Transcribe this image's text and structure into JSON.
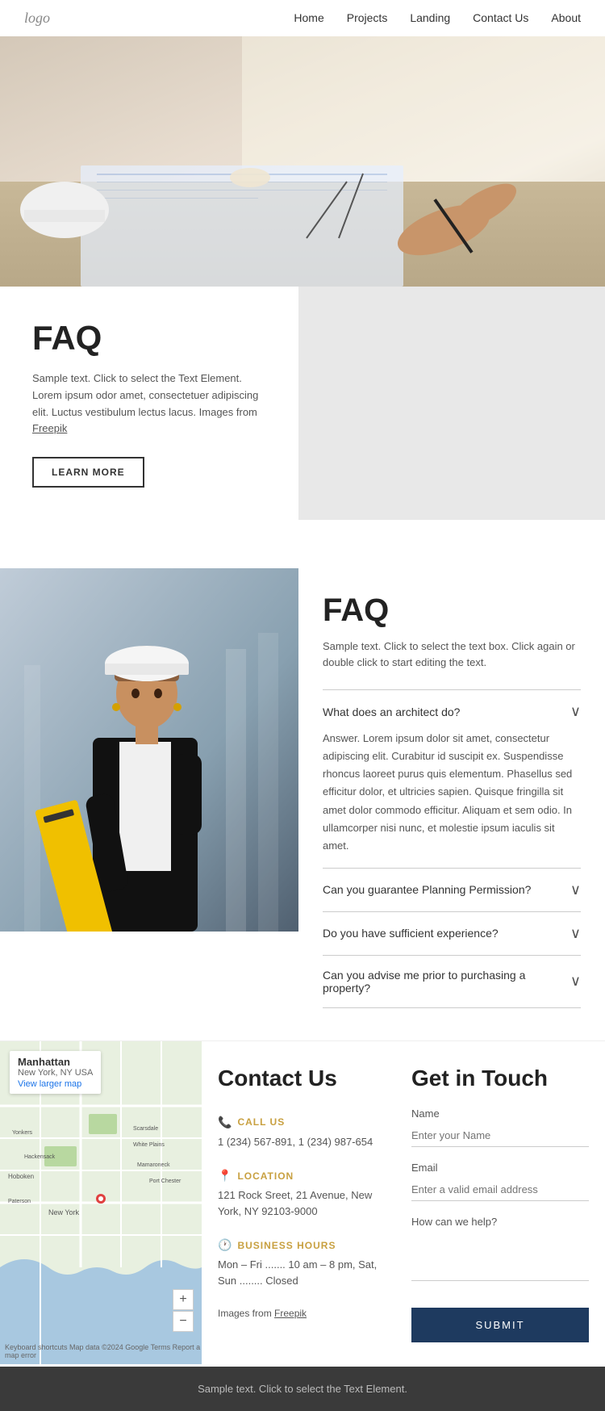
{
  "nav": {
    "logo": "logo",
    "links": [
      {
        "label": "Home",
        "href": "#"
      },
      {
        "label": "Projects",
        "href": "#"
      },
      {
        "label": "Landing",
        "href": "#"
      },
      {
        "label": "Contact Us",
        "href": "#"
      },
      {
        "label": "About",
        "href": "#"
      }
    ]
  },
  "faq1": {
    "title": "FAQ",
    "description": "Sample text. Click to select the Text Element. Lorem ipsum odor amet, consectetuer adipiscing elit. Luctus vestibulum lectus lacus. Images from",
    "freepik_link": "Freepik",
    "learn_more": "LEARN MORE"
  },
  "faq2": {
    "title": "FAQ",
    "description": "Sample text. Click to select the text box. Click again or double click to start editing the text.",
    "items": [
      {
        "question": "What does an architect do?",
        "answer": "Answer. Lorem ipsum dolor sit amet, consectetur adipiscing elit. Curabitur id suscipit ex. Suspendisse rhoncus laoreet purus quis elementum. Phasellus sed efficitur dolor, et ultricies sapien. Quisque fringilla sit amet dolor commodo efficitur. Aliquam et sem odio. In ullamcorper nisi nunc, et molestie ipsum iaculis sit amet.",
        "open": true
      },
      {
        "question": "Can you guarantee Planning Permission?",
        "answer": "",
        "open": false
      },
      {
        "question": "Do you have sufficient experience?",
        "answer": "",
        "open": false
      },
      {
        "question": "Can you advise me prior to purchasing a property?",
        "answer": "",
        "open": false
      }
    ]
  },
  "contact": {
    "title": "Contact Us",
    "map": {
      "city": "Manhattan",
      "state": "New York, NY USA",
      "view_larger": "View larger map",
      "attribution": "Keyboard shortcuts  Map data ©2024 Google  Terms  Report a map error"
    },
    "call_us": {
      "icon": "📞",
      "label": "CALL US",
      "value": "1 (234) 567-891, 1 (234) 987-654"
    },
    "location": {
      "icon": "📍",
      "label": "LOCATION",
      "value": "121 Rock Sreet, 21 Avenue, New York, NY 92103-9000"
    },
    "hours": {
      "icon": "🕐",
      "label": "BUSINESS HOURS",
      "value": "Mon – Fri ....... 10 am – 8 pm, Sat, Sun ........ Closed"
    },
    "images_text": "Images from",
    "freepik_link": "Freepik"
  },
  "form": {
    "title": "Get in Touch",
    "name_label": "Name",
    "name_placeholder": "Enter your Name",
    "email_label": "Email",
    "email_placeholder": "Enter a valid email address",
    "message_label": "How can we help?",
    "submit_label": "SUBMIT"
  },
  "footer": {
    "text": "Sample text. Click to select the Text Element."
  }
}
